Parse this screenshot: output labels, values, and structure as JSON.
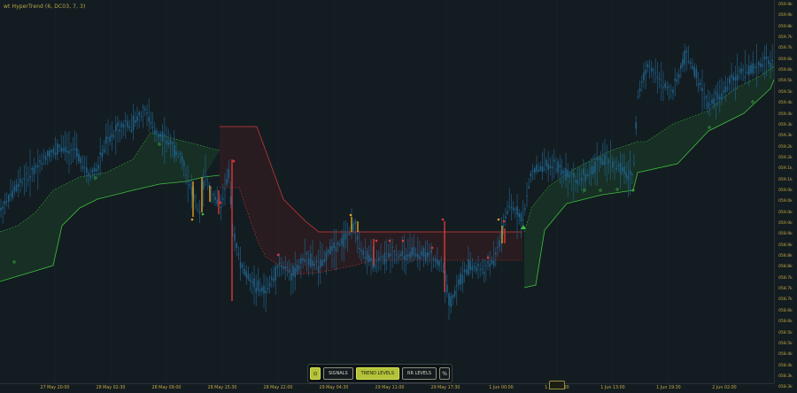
{
  "indicator": {
    "title": "wt HyperTrend (6, DC03, 7, 3)"
  },
  "colors": {
    "background": "#131c21",
    "candle": "#1f5f86",
    "up_trend": "#3fbf3f",
    "down_trend": "#d83a3a",
    "warning": "#e0a020",
    "axis_text": "#c4a843",
    "accent": "#b3c23a"
  },
  "price_axis": {
    "labels": [
      "059.9k",
      "059.9k",
      "059.8k",
      "059.7k",
      "059.7k",
      "059.6k",
      "059.6k",
      "059.5k",
      "059.5k",
      "059.4k",
      "059.4k",
      "059.3k",
      "059.3k",
      "059.2k",
      "059.2k",
      "059.1k",
      "059.1k",
      "059.0k",
      "059.0k",
      "059.0k",
      "059.0k",
      "058.9k",
      "058.9k",
      "058.8k",
      "058.8k",
      "058.7k",
      "058.7k",
      "058.7k",
      "058.6k",
      "058.6k",
      "058.5k",
      "058.5k",
      "058.4k",
      "058.4k",
      "058.3k",
      "058.3k"
    ],
    "values": [
      59.99,
      59.92,
      59.84,
      59.77,
      59.7,
      59.63,
      59.55,
      59.48,
      59.41,
      59.34,
      59.27,
      59.2,
      59.13,
      59.06,
      58.98,
      58.91,
      58.84,
      58.77,
      58.7,
      58.63,
      58.56,
      58.48,
      58.41,
      58.34,
      58.27,
      58.2,
      58.13,
      58.06,
      57.99,
      57.92,
      57.85,
      57.78,
      57.71,
      57.64,
      57.57,
      57.5
    ]
  },
  "time_axis": {
    "labels": [
      "27 May 20:00",
      "28 May 02:30",
      "28 May 09:00",
      "28 May 15:30",
      "28 May 22:00",
      "29 May 04:30",
      "29 May 11:00",
      "29 May 17:30",
      "1 Jun 00:00",
      "1 Jun 06:30",
      "1 Jun 13:00",
      "1 Jun 19:30",
      "2 Jun 02:00"
    ]
  },
  "toolbar": {
    "toggle_label": "⊙",
    "signals_label": "SIGNALS",
    "trend_levels_label": "TREND LEVELS",
    "rr_levels_label": "RR LEVELS",
    "percent_label": "%"
  }
}
